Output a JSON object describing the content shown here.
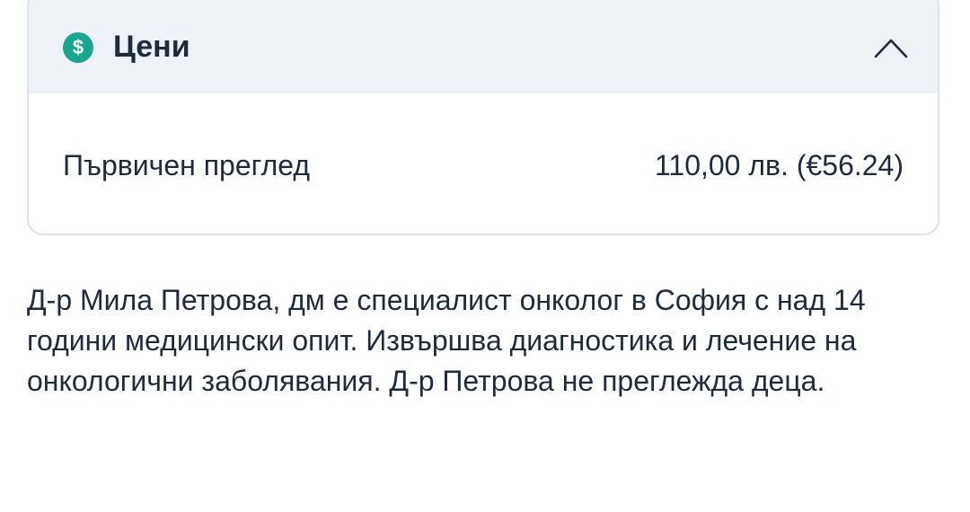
{
  "prices_section": {
    "icon": "dollar-icon",
    "title": "Цени",
    "expanded": true,
    "items": [
      {
        "label": "Първичен преглед",
        "price": "110,00 лв. (€56.24)"
      }
    ]
  },
  "description": "Д-р Мила Петрова, дм е специалист онколог в София с над 14 години медицински опит. Извършва диагностика и лечение на онкологични заболявания. Д-р Петрова не преглежда деца.",
  "colors": {
    "accent": "#1aa58f",
    "header_bg": "#eef2f6",
    "border": "#dde3ea",
    "text": "#1f2b3a"
  }
}
